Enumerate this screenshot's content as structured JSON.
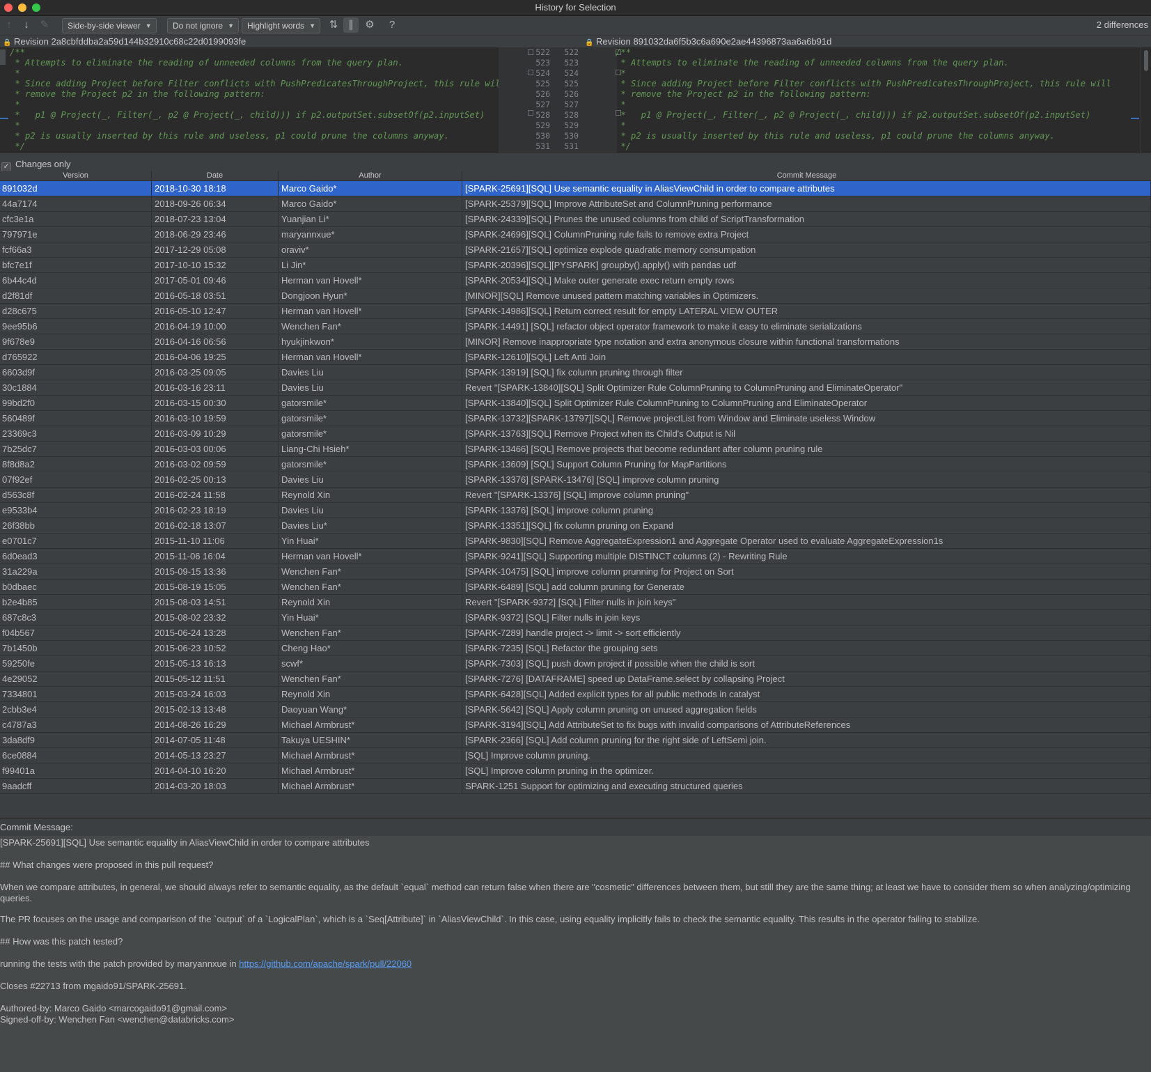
{
  "window": {
    "title": "History for Selection"
  },
  "toolbar": {
    "viewer_combo": "Side-by-side viewer",
    "ignore_combo": "Do not ignore",
    "highlight_combo": "Highlight words",
    "help_label": "?",
    "differences_count": "2 differences",
    "icons": [
      "arrow-up-icon",
      "arrow-down-icon",
      "edit-icon",
      "collapse-unchanged-icon",
      "sync-scroll-icon",
      "gear-icon",
      "help-icon"
    ]
  },
  "diff": {
    "left_revision": "Revision 2a8cbfddba2a59d144b32910c68c22d0199093fe",
    "right_revision": "Revision 891032da6f5b3c6a690e2ae44396873aa6a6b91d",
    "left_lines": [
      "/**",
      " * Attempts to eliminate the reading of unneeded columns from the query plan.",
      " *",
      " * Since adding Project before Filter conflicts with PushPredicatesThroughProject, this rule will",
      " * remove the Project p2 in the following pattern:",
      " *",
      " *   p1 @ Project(_, Filter(_, p2 @ Project(_, child))) if p2.outputSet.subsetOf(p2.inputSet)",
      " *",
      " * p2 is usually inserted by this rule and useless, p1 could prune the columns anyway.",
      " */"
    ],
    "right_lines": [
      "/**",
      " * Attempts to eliminate the reading of unneeded columns from the query plan.",
      " *",
      " * Since adding Project before Filter conflicts with PushPredicatesThroughProject, this rule will",
      " * remove the Project p2 in the following pattern:",
      " *",
      " *   p1 @ Project(_, Filter(_, p2 @ Project(_, child))) if p2.outputSet.subsetOf(p2.inputSet)",
      " *",
      " * p2 is usually inserted by this rule and useless, p1 could prune the columns anyway.",
      " */"
    ],
    "line_numbers": [
      "522",
      "523",
      "524",
      "525",
      "526",
      "527",
      "528",
      "529",
      "530",
      "531"
    ]
  },
  "filter": {
    "changes_only_label": "Changes only",
    "changes_only_checked": true
  },
  "table": {
    "columns": [
      "Version",
      "Date",
      "Author",
      "Commit Message"
    ],
    "rows": [
      [
        "891032d",
        "2018-10-30 18:18",
        "Marco Gaido*",
        "[SPARK-25691][SQL] Use semantic equality in AliasViewChild in order to compare attributes"
      ],
      [
        "44a7174",
        "2018-09-26 06:34",
        "Marco Gaido*",
        "[SPARK-25379][SQL] Improve AttributeSet and ColumnPruning performance"
      ],
      [
        "cfc3e1a",
        "2018-07-23 13:04",
        "Yuanjian Li*",
        "[SPARK-24339][SQL] Prunes the unused columns from child of ScriptTransformation"
      ],
      [
        "797971e",
        "2018-06-29 23:46",
        "maryannxue*",
        "[SPARK-24696][SQL] ColumnPruning rule fails to remove extra Project"
      ],
      [
        "fcf66a3",
        "2017-12-29 05:08",
        "oraviv*",
        "[SPARK-21657][SQL] optimize explode quadratic memory consumpation"
      ],
      [
        "bfc7e1f",
        "2017-10-10 15:32",
        "Li Jin*",
        "[SPARK-20396][SQL][PYSPARK] groupby().apply() with pandas udf"
      ],
      [
        "6b44c4d",
        "2017-05-01 09:46",
        "Herman van Hovell*",
        "[SPARK-20534][SQL] Make outer generate exec return empty rows"
      ],
      [
        "d2f81df",
        "2016-05-18 03:51",
        "Dongjoon Hyun*",
        "[MINOR][SQL] Remove unused pattern matching variables in Optimizers."
      ],
      [
        "d28c675",
        "2016-05-10 12:47",
        "Herman van Hovell*",
        "[SPARK-14986][SQL] Return correct result for empty LATERAL VIEW OUTER"
      ],
      [
        "9ee95b6",
        "2016-04-19 10:00",
        "Wenchen Fan*",
        "[SPARK-14491] [SQL] refactor object operator framework to make it easy to eliminate serializations"
      ],
      [
        "9f678e9",
        "2016-04-16 06:56",
        "hyukjinkwon*",
        "[MINOR] Remove inappropriate type notation and extra anonymous closure within functional transformations"
      ],
      [
        "d765922",
        "2016-04-06 19:25",
        "Herman van Hovell*",
        "[SPARK-12610][SQL] Left Anti Join"
      ],
      [
        "6603d9f",
        "2016-03-25 09:05",
        "Davies Liu",
        "[SPARK-13919] [SQL] fix column pruning through filter"
      ],
      [
        "30c1884",
        "2016-03-16 23:11",
        "Davies Liu",
        "Revert \"[SPARK-13840][SQL] Split Optimizer Rule ColumnPruning to ColumnPruning and EliminateOperator\""
      ],
      [
        "99bd2f0",
        "2016-03-15 00:30",
        "gatorsmile*",
        "[SPARK-13840][SQL] Split Optimizer Rule ColumnPruning to ColumnPruning and EliminateOperator"
      ],
      [
        "560489f",
        "2016-03-10 19:59",
        "gatorsmile*",
        "[SPARK-13732][SPARK-13797][SQL] Remove projectList from Window and Eliminate useless Window"
      ],
      [
        "23369c3",
        "2016-03-09 10:29",
        "gatorsmile*",
        "[SPARK-13763][SQL] Remove Project when its Child's Output is Nil"
      ],
      [
        "7b25dc7",
        "2016-03-03 00:06",
        "Liang-Chi Hsieh*",
        "[SPARK-13466] [SQL] Remove projects that become redundant after column pruning rule"
      ],
      [
        "8f8d8a2",
        "2016-03-02 09:59",
        "gatorsmile*",
        "[SPARK-13609] [SQL] Support Column Pruning for MapPartitions"
      ],
      [
        "07f92ef",
        "2016-02-25 00:13",
        "Davies Liu",
        "[SPARK-13376] [SPARK-13476] [SQL] improve column pruning"
      ],
      [
        "d563c8f",
        "2016-02-24 11:58",
        "Reynold Xin",
        "Revert \"[SPARK-13376] [SQL] improve column pruning\""
      ],
      [
        "e9533b4",
        "2016-02-23 18:19",
        "Davies Liu",
        "[SPARK-13376] [SQL] improve column pruning"
      ],
      [
        "26f38bb",
        "2016-02-18 13:07",
        "Davies Liu*",
        "[SPARK-13351][SQL] fix column pruning on Expand"
      ],
      [
        "e0701c7",
        "2015-11-10 11:06",
        "Yin Huai*",
        "[SPARK-9830][SQL] Remove AggregateExpression1 and Aggregate Operator used to evaluate AggregateExpression1s"
      ],
      [
        "6d0ead3",
        "2015-11-06 16:04",
        "Herman van Hovell*",
        "[SPARK-9241][SQL] Supporting multiple DISTINCT columns (2) - Rewriting Rule"
      ],
      [
        "31a229a",
        "2015-09-15 13:36",
        "Wenchen Fan*",
        "[SPARK-10475] [SQL] improve column prunning for Project on Sort"
      ],
      [
        "b0dbaec",
        "2015-08-19 15:05",
        "Wenchen Fan*",
        "[SPARK-6489] [SQL] add column pruning for Generate"
      ],
      [
        "b2e4b85",
        "2015-08-03 14:51",
        "Reynold Xin",
        "Revert \"[SPARK-9372] [SQL] Filter nulls in join keys\""
      ],
      [
        "687c8c3",
        "2015-08-02 23:32",
        "Yin Huai*",
        "[SPARK-9372] [SQL] Filter nulls in join keys"
      ],
      [
        "f04b567",
        "2015-06-24 13:28",
        "Wenchen Fan*",
        "[SPARK-7289] handle project -> limit -> sort efficiently"
      ],
      [
        "7b1450b",
        "2015-06-23 10:52",
        "Cheng Hao*",
        "[SPARK-7235] [SQL] Refactor the grouping sets"
      ],
      [
        "59250fe",
        "2015-05-13 16:13",
        "scwf*",
        "[SPARK-7303] [SQL] push down project if possible when the child is sort"
      ],
      [
        "4e29052",
        "2015-05-12 11:51",
        "Wenchen Fan*",
        "[SPARK-7276] [DATAFRAME] speed up DataFrame.select by collapsing Project"
      ],
      [
        "7334801",
        "2015-03-24 16:03",
        "Reynold Xin",
        "[SPARK-6428][SQL] Added explicit types for all public methods in catalyst"
      ],
      [
        "2cbb3e4",
        "2015-02-13 13:48",
        "Daoyuan Wang*",
        "[SPARK-5642] [SQL] Apply column pruning on unused aggregation fields"
      ],
      [
        "c4787a3",
        "2014-08-26 16:29",
        "Michael Armbrust*",
        "[SPARK-3194][SQL] Add AttributeSet to fix bugs with invalid comparisons of AttributeReferences"
      ],
      [
        "3da8df9",
        "2014-07-05 11:48",
        "Takuya UESHIN*",
        "[SPARK-2366] [SQL] Add column pruning for the right side of LeftSemi join."
      ],
      [
        "6ce0884",
        "2014-05-13 23:27",
        "Michael Armbrust*",
        "[SQL] Improve column pruning."
      ],
      [
        "f99401a",
        "2014-04-10 16:20",
        "Michael Armbrust*",
        "[SQL] Improve column pruning in the optimizer."
      ],
      [
        "9aadcff",
        "2014-03-20 18:03",
        "Michael Armbrust*",
        "SPARK-1251 Support for optimizing and executing structured queries"
      ]
    ]
  },
  "commit": {
    "label": "Commit Message:",
    "title": "[SPARK-25691][SQL] Use semantic equality in AliasViewChild in order to compare attributes",
    "h1": "## What changes were proposed in this pull request?",
    "p1": "When we compare attributes, in general, we should always refer to semantic equality, as the default `equal` method can return false when there are \"cosmetic\" differences between them, but still they are the same thing; at least we have to consider them so when analyzing/optimizing queries.",
    "p2": "The PR focuses on the usage and comparison of the `output` of a `LogicalPlan`, which is a `Seq[Attribute]` in `AliasViewChild`. In this case, using equality implicitly fails to check the semantic equality. This results in the operator failing to stabilize.",
    "h2": "## How was this patch tested?",
    "p3_prefix": "running the tests with the patch provided by maryannxue in ",
    "p3_link": "https://github.com/apache/spark/pull/22060",
    "p4": "Closes #22713 from mgaido91/SPARK-25691.",
    "authored": "Authored-by: Marco Gaido <marcogaido91@gmail.com>",
    "signed": "Signed-off-by: Wenchen Fan <wenchen@databricks.com>"
  }
}
